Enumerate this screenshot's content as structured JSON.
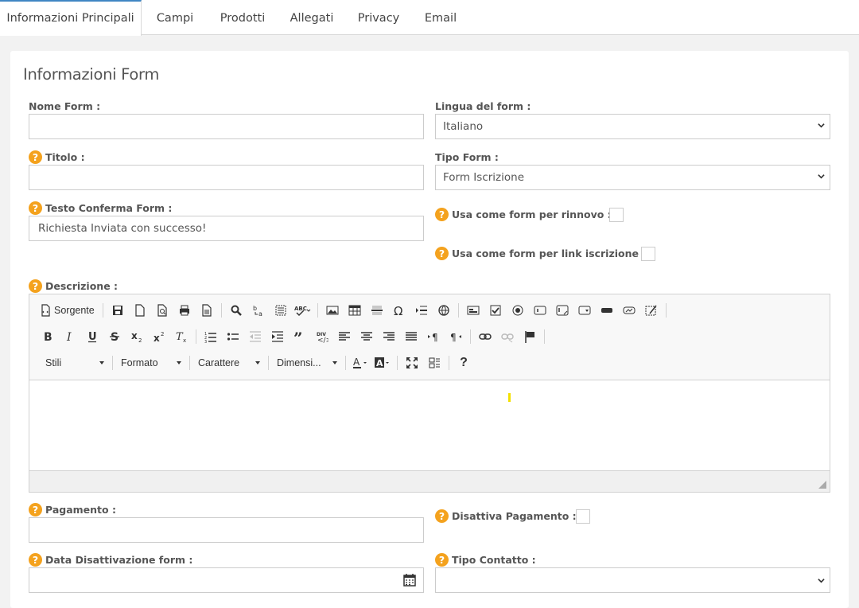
{
  "tabs": [
    {
      "label": "Informazioni Principali",
      "active": true
    },
    {
      "label": "Campi"
    },
    {
      "label": "Prodotti"
    },
    {
      "label": "Allegati"
    },
    {
      "label": "Privacy"
    },
    {
      "label": "Email"
    }
  ],
  "section_title": "Informazioni Form",
  "fields": {
    "nome_form": {
      "label": "Nome Form :",
      "value": ""
    },
    "lingua": {
      "label": "Lingua del form :",
      "value": "Italiano"
    },
    "titolo": {
      "label": "Titolo :",
      "value": ""
    },
    "tipo_form": {
      "label": "Tipo Form :",
      "value": "Form Iscrizione"
    },
    "testo_conferma": {
      "label": "Testo Conferma Form :",
      "value": "Richiesta Inviata con successo!"
    },
    "rinnovo": {
      "label": "Usa come form per rinnovo :",
      "checked": false
    },
    "link_iscrizione": {
      "label": "Usa come form per link iscrizione :",
      "checked": false
    },
    "descrizione": {
      "label": "Descrizione :"
    },
    "pagamento": {
      "label": "Pagamento :",
      "value": ""
    },
    "disattiva_pagamento": {
      "label": "Disattiva Pagamento :",
      "checked": false
    },
    "data_disattivazione": {
      "label": "Data Disattivazione form :",
      "value": ""
    },
    "tipo_contatto": {
      "label": "Tipo Contatto :",
      "value": ""
    }
  },
  "editor": {
    "source_label": "Sorgente",
    "combos": {
      "stili": "Stili",
      "formato": "Formato",
      "carattere": "Carattere",
      "dimensione": "Dimensi..."
    },
    "help_glyph": "?"
  },
  "colors": {
    "accent": "#3f86c3",
    "help": "#f4a21e"
  }
}
